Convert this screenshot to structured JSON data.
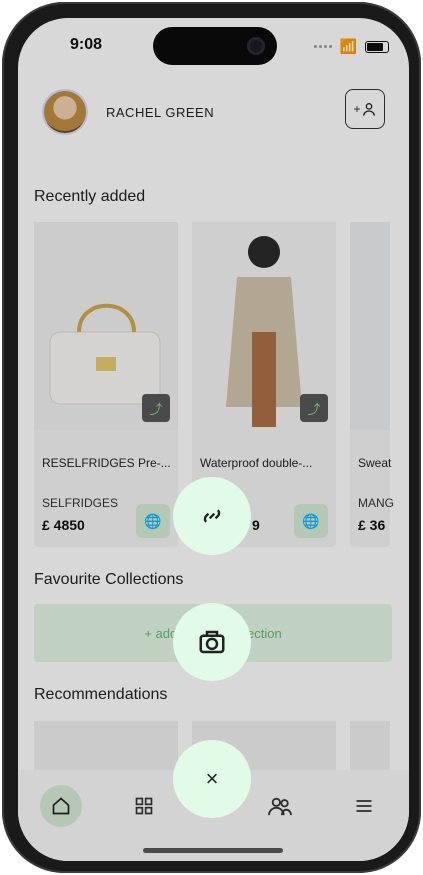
{
  "status_bar": {
    "time": "9:08"
  },
  "user": {
    "name": "RACHEL GREEN",
    "add_user_label": "+"
  },
  "sections": {
    "recently_added": "Recently added",
    "favourite_collections": "Favourite Collections",
    "recommendations": "Recommendations"
  },
  "recent_items": [
    {
      "title": "RESELFRIDGES Pre-...",
      "brand": "SELFRIDGES",
      "price": "£ 4850"
    },
    {
      "title": "Waterproof double-...",
      "brand": "",
      "price": "9"
    },
    {
      "title": "Sweat",
      "brand": "MANG",
      "price": "£ 36"
    }
  ],
  "collections": {
    "add_label": "+ add",
    "collection_text": "llection"
  },
  "fabs": {
    "link": "link-icon",
    "camera": "camera-icon",
    "close": "×"
  },
  "tabbar": {
    "home": "home-icon",
    "grid": "grid-icon",
    "people": "people-icon",
    "menu": "menu-icon"
  }
}
